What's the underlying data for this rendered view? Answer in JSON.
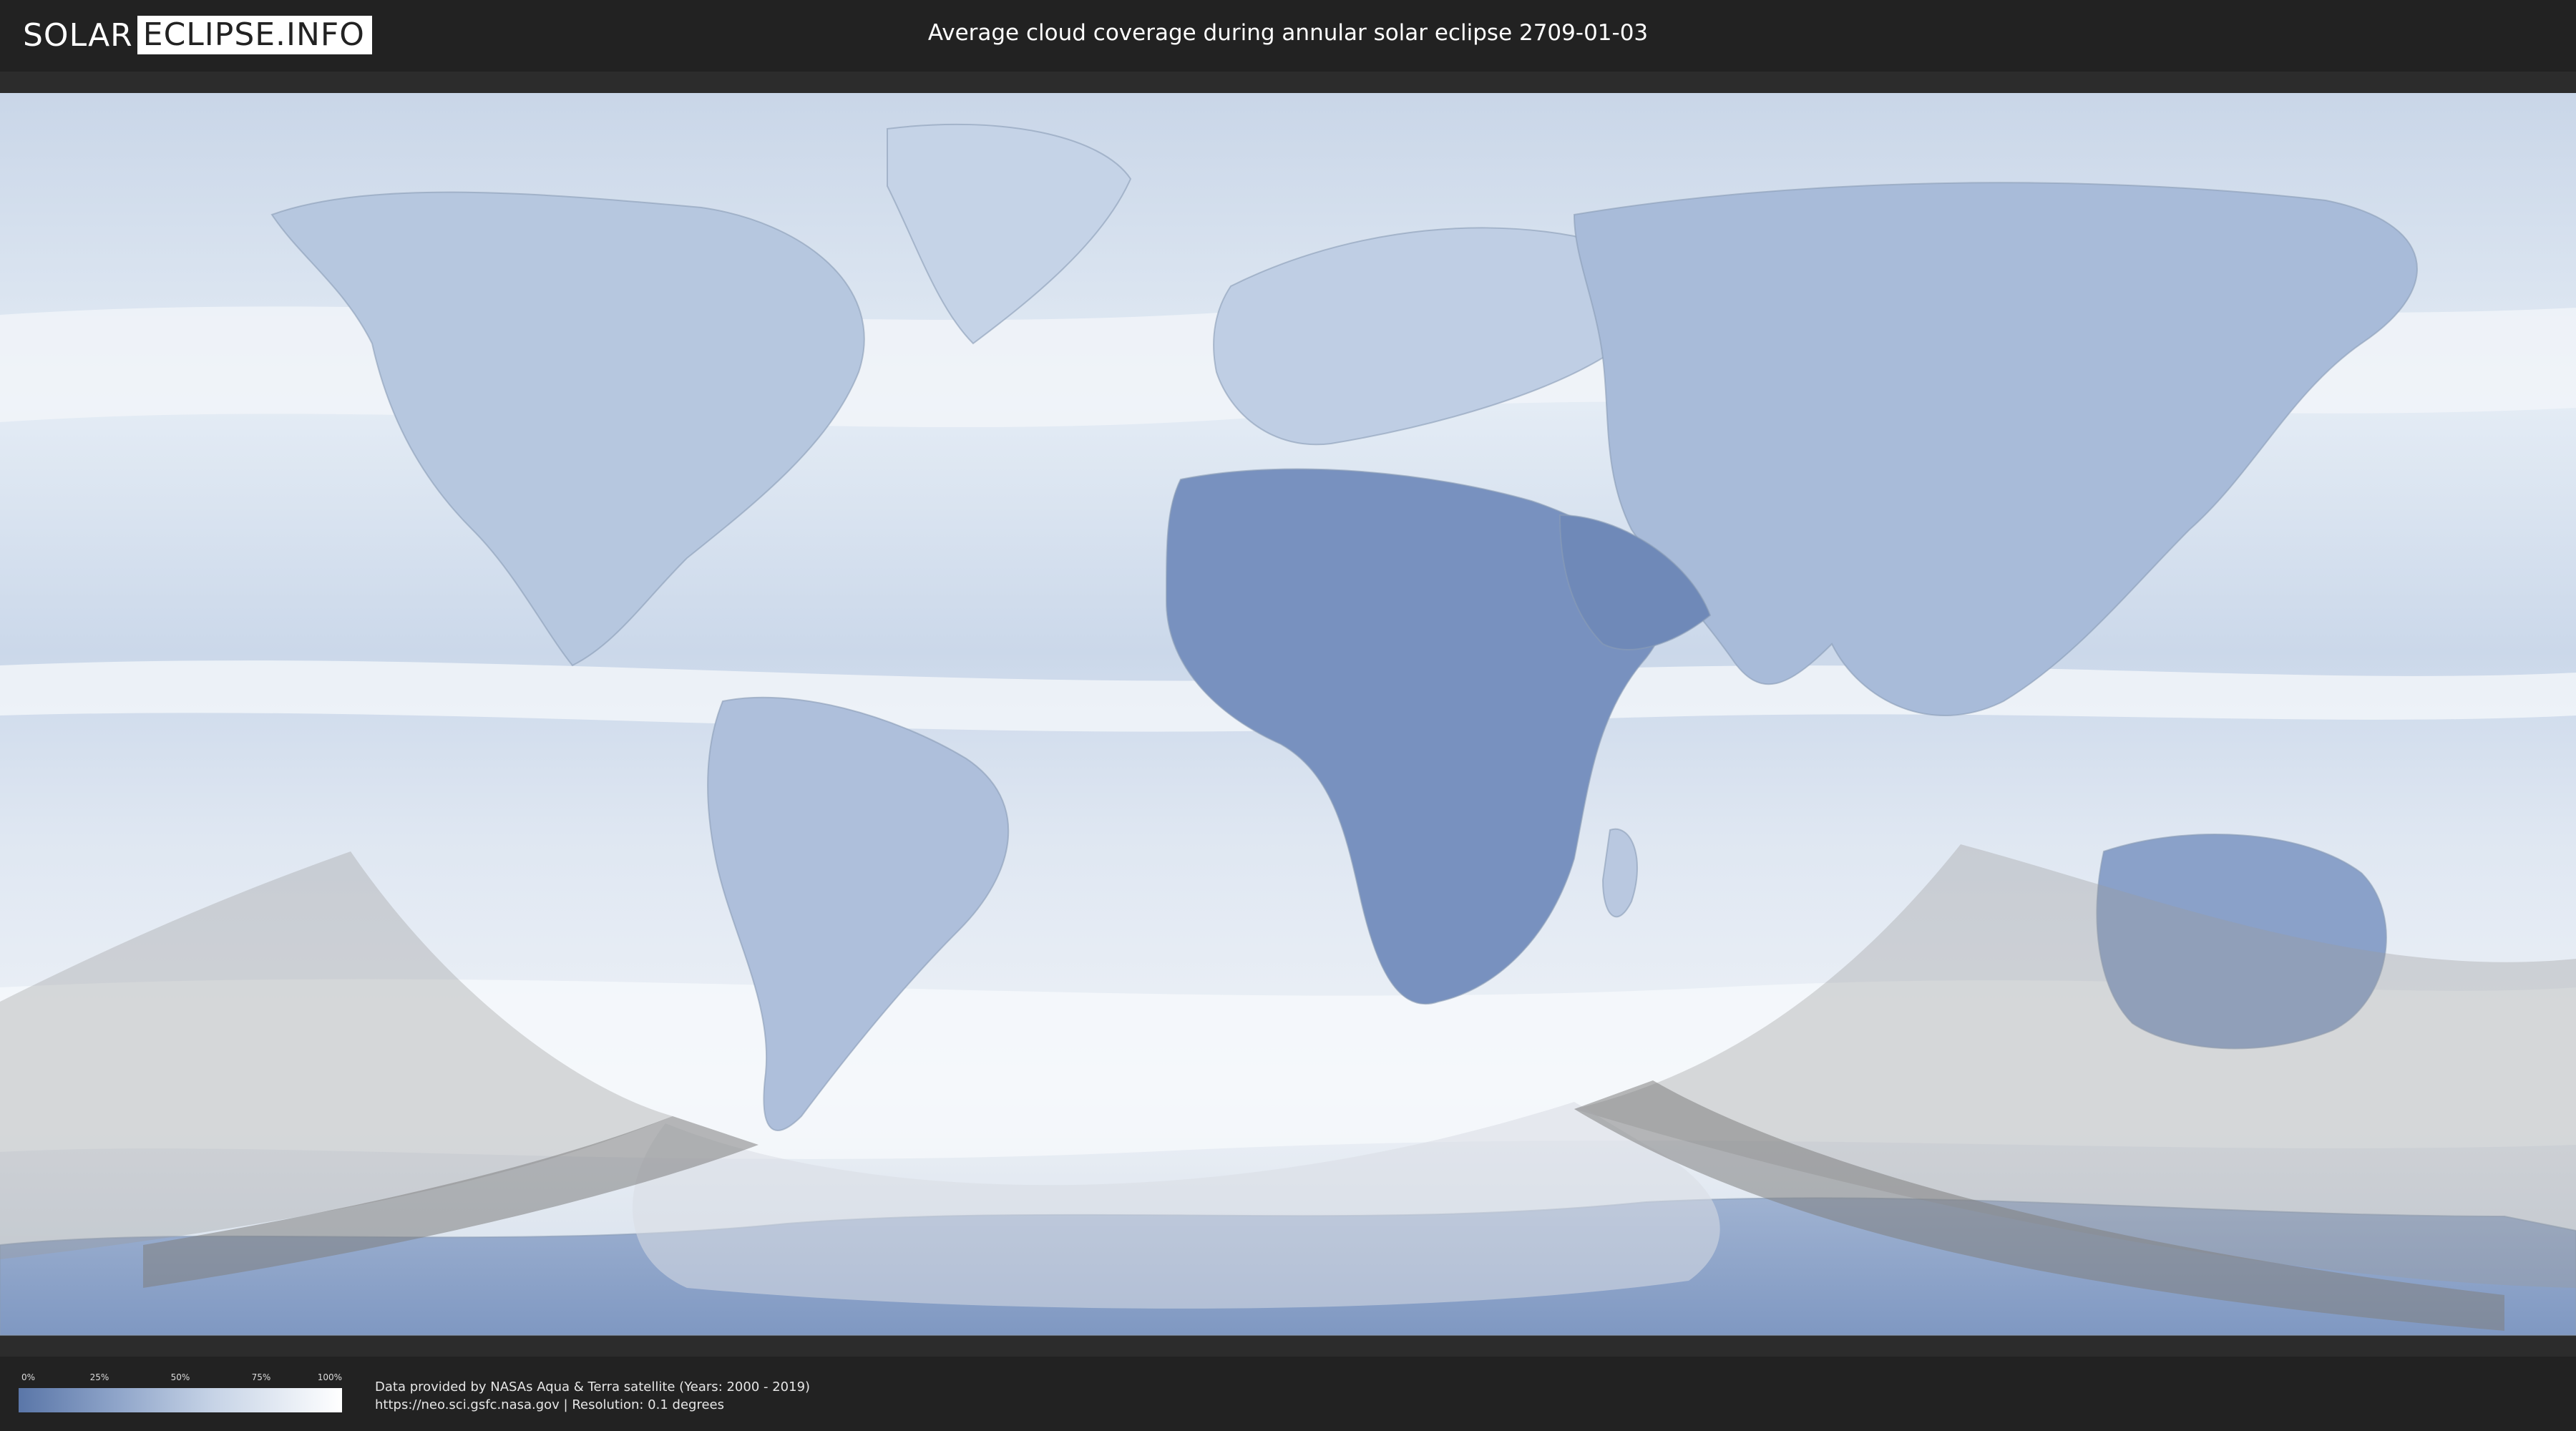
{
  "header": {
    "logo_left": "SOLAR",
    "logo_right": "ECLIPSE.INFO",
    "title": "Average cloud coverage during annular solar eclipse 2709-01-03"
  },
  "legend": {
    "labels": [
      "0%",
      "25%",
      "50%",
      "75%",
      "100%"
    ],
    "colors": {
      "low": "#5a76a8",
      "high": "#ffffff"
    }
  },
  "credits": {
    "line1": "Data provided by NASAs Aqua & Terra satellite (Years: 2000 - 2019)",
    "line2": "https://neo.sci.gsfc.nasa.gov | Resolution: 0.1 degrees"
  },
  "map": {
    "type": "cloud-coverage-world-map",
    "colors": {
      "ocean_cloud": "#dfe8f3",
      "land_clear": "#6e89b8",
      "eclipse_shadow": "#9a9a9a"
    }
  }
}
